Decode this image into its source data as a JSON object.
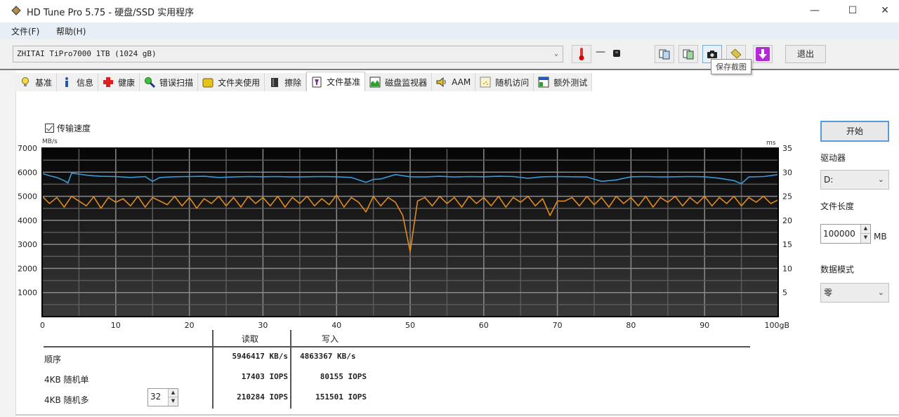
{
  "window": {
    "title": "HD Tune Pro 5.75 - 硬盘/SSD 实用程序",
    "controls": {
      "minimize": "—",
      "maximize": "☐",
      "close": "✕"
    }
  },
  "menu": [
    {
      "label": "文件(F)"
    },
    {
      "label": "帮助(H)"
    }
  ],
  "toolbar": {
    "drive": "ZHITAI TiPro7000 1TB (1024 gB)",
    "temperature": "—",
    "exit_label": "退出",
    "tooltip": "保存截图",
    "buttons": [
      "copy-text-icon",
      "copy-image-icon",
      "camera-icon",
      "tag-icon",
      "download-icon"
    ]
  },
  "tabs": [
    {
      "label": "基准",
      "icon": "bulb-icon"
    },
    {
      "label": "信息",
      "icon": "info-icon"
    },
    {
      "label": "健康",
      "icon": "health-cross-icon"
    },
    {
      "label": "错误扫描",
      "icon": "magnifier-icon"
    },
    {
      "label": "文件夹使用",
      "icon": "folder-icon"
    },
    {
      "label": "擦除",
      "icon": "trash-icon"
    },
    {
      "label": "文件基准",
      "icon": "file-benchmark-icon",
      "active": true
    },
    {
      "label": "磁盘监视器",
      "icon": "monitor-chart-icon"
    },
    {
      "label": "AAM",
      "icon": "speaker-icon"
    },
    {
      "label": "随机访问",
      "icon": "random-access-icon"
    },
    {
      "label": "额外测试",
      "icon": "extra-tests-icon"
    }
  ],
  "options": {
    "transfer_speed_label": "传输速度",
    "transfer_speed_checked": true
  },
  "right_panel": {
    "start_label": "开始",
    "drive_label": "驱动器",
    "drive_value": "D:",
    "file_length_label": "文件长度",
    "file_length_value": "100000",
    "file_length_unit": "MB",
    "data_mode_label": "数据模式",
    "data_mode_value": "零"
  },
  "results": {
    "headers": {
      "read": "读取",
      "write": "写入"
    },
    "rows": [
      {
        "label": "顺序",
        "read": "5946417 KB/s",
        "write": "4863367 KB/s"
      },
      {
        "label": "4KB 随机单",
        "read": "17403 IOPS",
        "write": "80155 IOPS"
      },
      {
        "label": "4KB 随机多",
        "read": "210284 IOPS",
        "write": "151501 IOPS",
        "queue_depth": "32"
      }
    ]
  },
  "chart_data": {
    "type": "line",
    "title": "",
    "xlabel": "gB",
    "ylabel": "MB/s",
    "y2label": "ms",
    "xlim": [
      0,
      100
    ],
    "ylim": [
      0,
      7000
    ],
    "y2lim": [
      0,
      35
    ],
    "x_ticks": [
      "0",
      "10",
      "20",
      "30",
      "40",
      "50",
      "60",
      "70",
      "80",
      "90",
      "100gB"
    ],
    "y_ticks": [
      "1000",
      "2000",
      "3000",
      "4000",
      "5000",
      "6000",
      "7000"
    ],
    "y2_ticks": [
      "5",
      "10",
      "15",
      "20",
      "25",
      "30",
      "35"
    ],
    "grid": true,
    "series": [
      {
        "name": "读取",
        "color": "#3a9ad9",
        "x": [
          0,
          1,
          2,
          3,
          3.5,
          4,
          5,
          6,
          7,
          8,
          10,
          12,
          14,
          15,
          16,
          18,
          20,
          22,
          24,
          26,
          28,
          30,
          32,
          34,
          36,
          38,
          40,
          42,
          44,
          45,
          46,
          48,
          50,
          52,
          54,
          56,
          58,
          60,
          62,
          64,
          66,
          68,
          70,
          72,
          74,
          76,
          78,
          80,
          82,
          84,
          86,
          88,
          90,
          92,
          94,
          95,
          96,
          98,
          100
        ],
        "values": [
          5950,
          5850,
          5780,
          5650,
          5550,
          5960,
          5920,
          5880,
          5850,
          5830,
          5820,
          5780,
          5820,
          5620,
          5780,
          5810,
          5820,
          5830,
          5780,
          5800,
          5820,
          5810,
          5820,
          5800,
          5810,
          5820,
          5810,
          5780,
          5580,
          5700,
          5720,
          5900,
          5810,
          5800,
          5830,
          5800,
          5820,
          5810,
          5830,
          5820,
          5750,
          5810,
          5820,
          5810,
          5800,
          5620,
          5680,
          5810,
          5820,
          5800,
          5810,
          5820,
          5810,
          5750,
          5650,
          5520,
          5800,
          5820,
          5900
        ]
      },
      {
        "name": "写入",
        "color": "#e08a1e",
        "x": [
          0,
          1,
          2,
          3,
          4,
          5,
          6,
          7,
          8,
          9,
          10,
          11,
          12,
          13,
          14,
          15,
          16,
          17,
          18,
          19,
          20,
          21,
          22,
          23,
          24,
          25,
          26,
          27,
          28,
          29,
          30,
          31,
          32,
          33,
          34,
          35,
          36,
          37,
          38,
          39,
          40,
          41,
          42,
          43,
          44,
          45,
          46,
          47,
          48,
          49,
          50,
          51,
          52,
          53,
          54,
          55,
          56,
          57,
          58,
          59,
          60,
          61,
          62,
          63,
          64,
          65,
          66,
          67,
          68,
          69,
          70,
          71,
          72,
          73,
          74,
          75,
          76,
          77,
          78,
          79,
          80,
          81,
          82,
          83,
          84,
          85,
          86,
          87,
          88,
          89,
          90,
          91,
          92,
          93,
          94,
          95,
          96,
          97,
          98,
          99,
          100
        ],
        "values": [
          5000,
          4700,
          4950,
          4550,
          5000,
          4800,
          4600,
          4980,
          4500,
          4950,
          4750,
          4900,
          4600,
          5000,
          4550,
          4950,
          4800,
          4650,
          5000,
          4600,
          4950,
          4500,
          4900,
          4700,
          5000,
          4600,
          4950,
          4550,
          5000,
          4700,
          4950,
          4600,
          5000,
          4550,
          4950,
          4700,
          5000,
          4600,
          4900,
          4650,
          5050,
          4550,
          4950,
          4750,
          4350,
          5000,
          4600,
          4950,
          4750,
          4200,
          2700,
          4800,
          4950,
          4600,
          5000,
          4700,
          4950,
          4550,
          5000,
          4700,
          4950,
          4600,
          5000,
          4550,
          4950,
          4750,
          5000,
          4600,
          4900,
          4200,
          4800,
          4800,
          4950,
          4600,
          5000,
          4650,
          4950,
          4550,
          5000,
          4700,
          4950,
          4600,
          5000,
          4550,
          4950,
          4750,
          5000,
          4600,
          4950,
          4700,
          5000,
          4600,
          4950,
          4700,
          5000,
          4600,
          4950,
          4750,
          5000,
          4700,
          4850
        ]
      }
    ]
  }
}
